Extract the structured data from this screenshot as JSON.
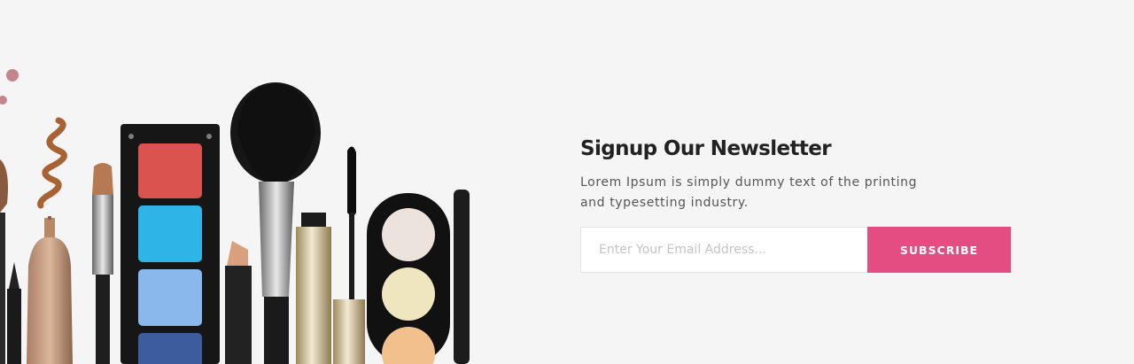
{
  "newsletter": {
    "title": "Signup Our Newsletter",
    "description": "Lorem Ipsum is simply dummy text of the printing and typesetting industry.",
    "email_placeholder": "Enter Your Email Address...",
    "subscribe_label": "SUBSCRIBE"
  },
  "colors": {
    "background": "#f5f5f5",
    "accent": "#e34d82",
    "title": "#222222",
    "text": "#555555"
  },
  "illustration": {
    "subject": "makeup products",
    "palette_swatches": [
      "#d9534f",
      "#2eb4e6",
      "#8ab8ec",
      "#3d5c9e"
    ],
    "compact_shades": [
      "#ece4dc",
      "#efe6bf",
      "#f2c08c"
    ]
  }
}
